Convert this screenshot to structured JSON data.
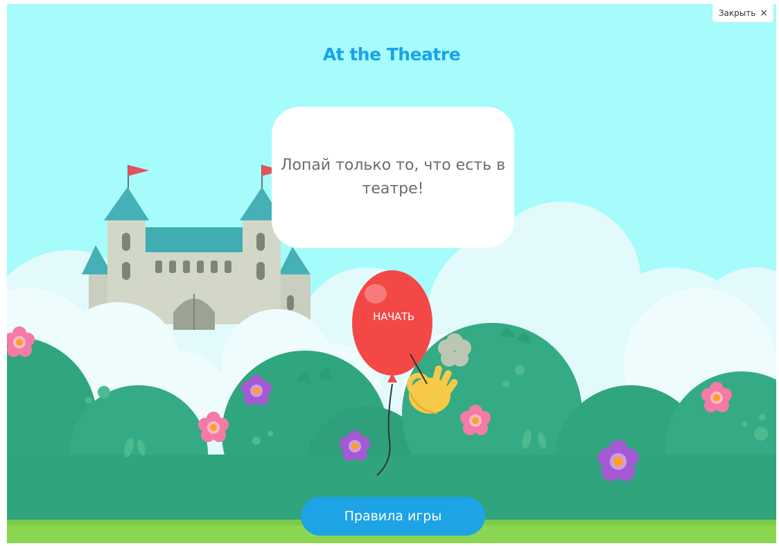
{
  "header": {
    "close_label": "Закрыть",
    "close_icon": "×"
  },
  "game": {
    "title": "At the Theatre",
    "instruction": "Лопай только то, что есть в театре!",
    "start_label": "НАЧАТЬ",
    "rules_label": "Правила игры"
  },
  "colors": {
    "sky": "#a6fbfb",
    "title": "#1aa2ea",
    "balloon": "#f44847",
    "rules_button": "#1da3e6",
    "bush": "#2ea680",
    "grass": "#8bd650"
  },
  "icons": {
    "hint": "ok-hand-icon",
    "balloon": "balloon-icon"
  }
}
